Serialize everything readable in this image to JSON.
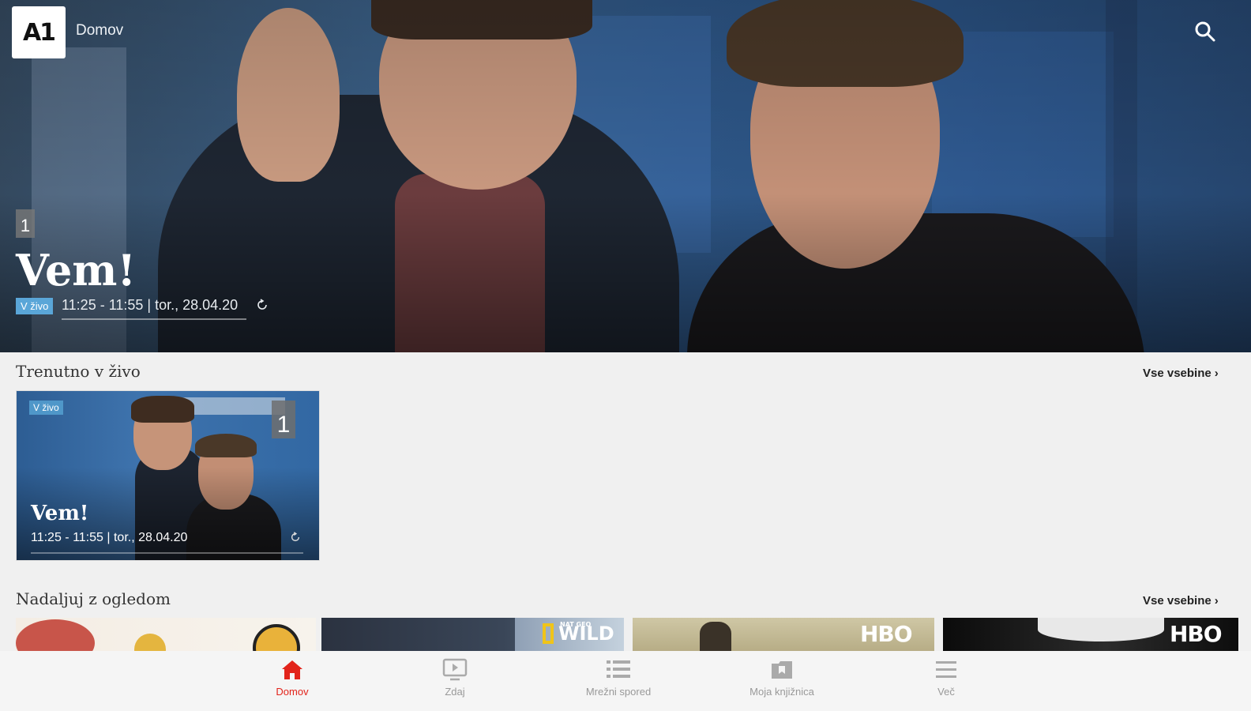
{
  "header": {
    "logo_text": "A1",
    "breadcrumb": "Domov",
    "search_icon": "search-icon"
  },
  "hero": {
    "channel_number": "1",
    "title": "Vem!",
    "live_label": "V živo",
    "time": "11:25 - 11:55 | tor., 28.04.20",
    "restart_icon": "restart-icon"
  },
  "live_section": {
    "title": "Trenutno v živo",
    "see_all": "Vse vsebine",
    "cards": [
      {
        "live_label": "V živo",
        "channel_number": "1",
        "title": "Vem!",
        "time": "11:25 - 11:55 | tor., 28.04.20"
      }
    ]
  },
  "continue_section": {
    "title": "Nadaljuj z ogledom",
    "see_all": "Vse vsebine",
    "thumbnails": [
      {
        "brand": ""
      },
      {
        "brand": "WILD",
        "brand_sub": "NAT GEO"
      },
      {
        "brand": "HBO"
      },
      {
        "brand": "HBO"
      }
    ]
  },
  "bottom_nav": {
    "items": [
      {
        "label": "Domov",
        "icon": "home-icon",
        "active": true
      },
      {
        "label": "Zdaj",
        "icon": "tv-play-icon",
        "active": false
      },
      {
        "label": "Mrežni spored",
        "icon": "list-icon",
        "active": false
      },
      {
        "label": "Moja knjižnica",
        "icon": "library-icon",
        "active": false
      },
      {
        "label": "Več",
        "icon": "menu-icon",
        "active": false
      }
    ]
  },
  "colors": {
    "accent": "#e2231a",
    "live": "#5aa6d8",
    "background": "#f0f0f0"
  }
}
